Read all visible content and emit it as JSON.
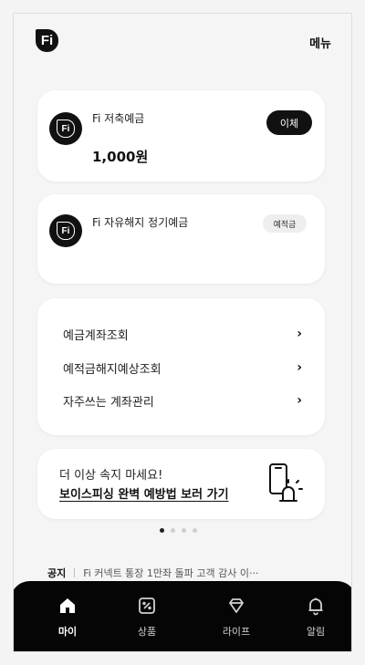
{
  "header": {
    "logo_text": "Fi",
    "menu_label": "메뉴"
  },
  "accounts": [
    {
      "icon_text": "Fi",
      "name": "Fi 저축예금",
      "balance": "1,000원",
      "action_label": "이체"
    },
    {
      "icon_text": "Fi",
      "name": "Fi 자유해지 정기예금",
      "badge_label": "예적금"
    }
  ],
  "menu_list": {
    "items": [
      {
        "label": "예금계좌조회"
      },
      {
        "label": "예적금해지예상조회"
      },
      {
        "label": "자주쓰는 계좌관리"
      }
    ]
  },
  "banner": {
    "line1": "더 이상 속지 마세요!",
    "line2": "보이스피싱 완벽 예방법 보러 가기"
  },
  "carousel": {
    "total_pages": 4,
    "active_page": 1
  },
  "notice": {
    "label": "공지",
    "text": "Fi 커넥트 통장 1만좌 돌파 고객 감사 이···"
  },
  "tabbar": {
    "tabs": [
      {
        "label": "마이",
        "icon": "home-icon",
        "active": true
      },
      {
        "label": "상품",
        "icon": "percent-icon",
        "active": false
      },
      {
        "label": "라이프",
        "icon": "diamond-icon",
        "active": false
      },
      {
        "label": "알림",
        "icon": "bell-icon",
        "active": false
      }
    ]
  },
  "colors": {
    "background": "#f5f5f5",
    "card": "#ffffff",
    "primary": "#111111",
    "tabbar": "#050505"
  }
}
